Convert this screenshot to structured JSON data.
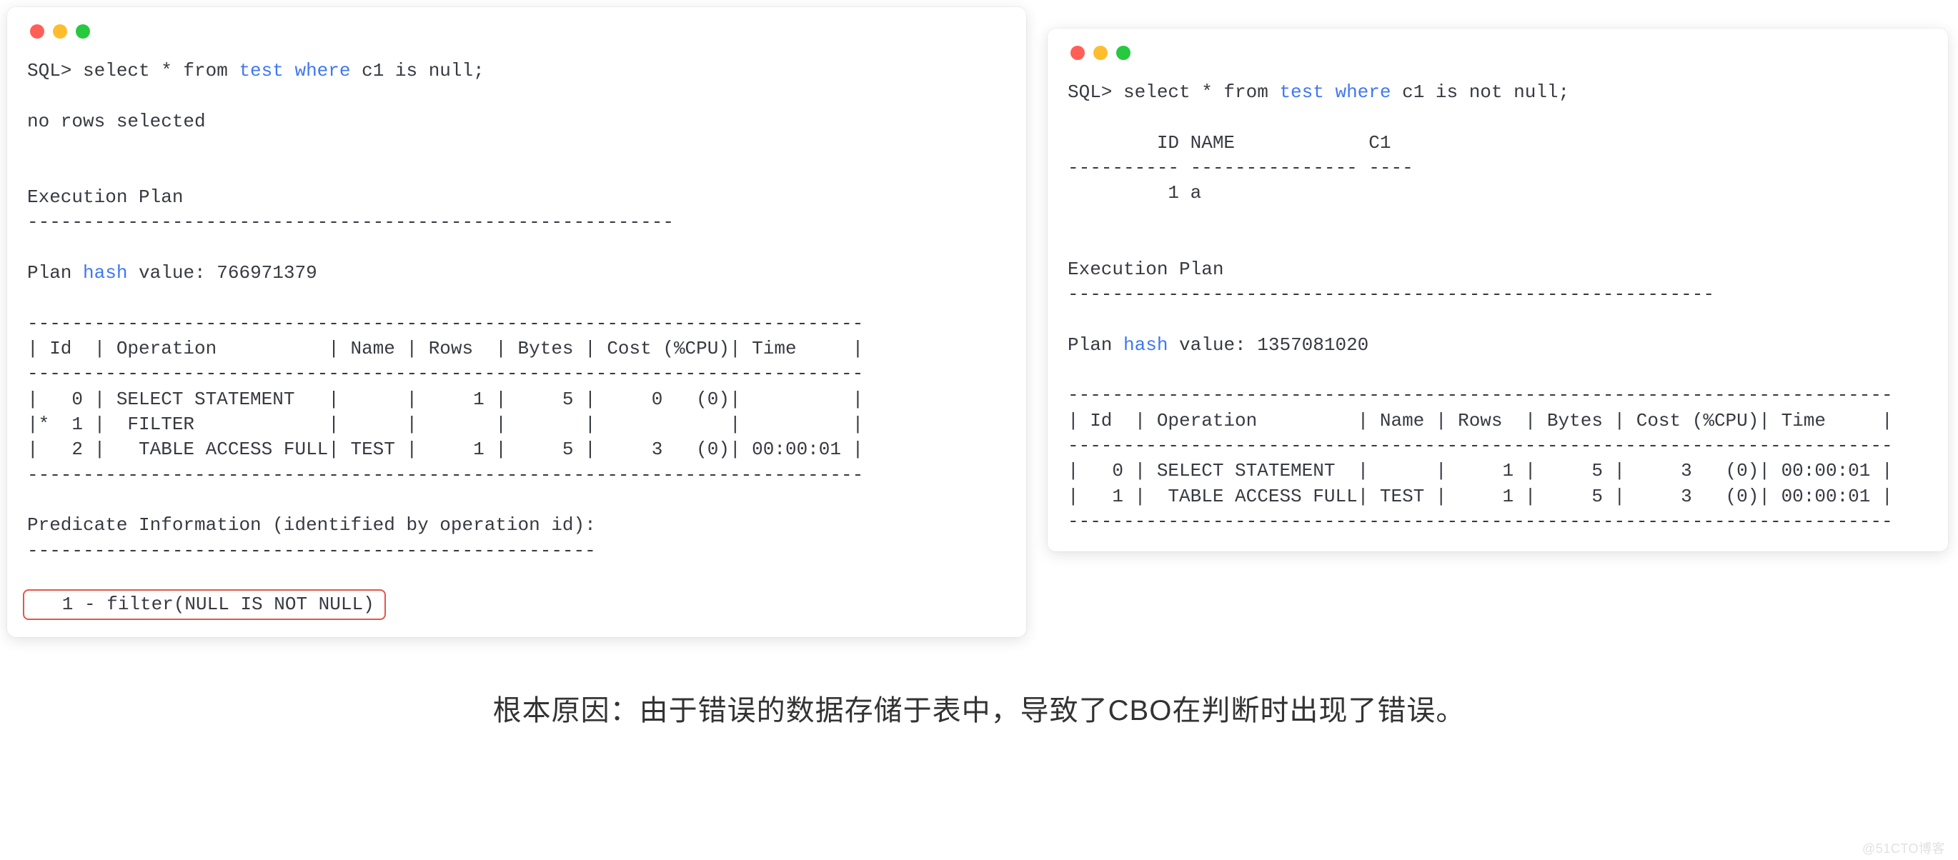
{
  "left": {
    "query_line": {
      "prefix": "SQL> select * from ",
      "kw": "test where",
      "suffix": " c1 is null;"
    },
    "no_rows": "no rows selected",
    "exec_label": "Execution Plan",
    "dash58": "----------------------------------------------------------",
    "hash_line": {
      "prefix": "Plan ",
      "kw": "hash",
      "suffix": " value: 766971379"
    },
    "dash75": "---------------------------------------------------------------------------",
    "header": "| Id  | Operation          | Name | Rows  | Bytes | Cost (%CPU)| Time     |",
    "row0": "|   0 | SELECT STATEMENT   |      |     1 |     5 |     0   (0)|          |",
    "row1": "|*  1 |  FILTER            |      |       |       |            |          |",
    "row2": "|   2 |   TABLE ACCESS FULL| TEST |     1 |     5 |     3   (0)| 00:00:01 |",
    "pred_label": "Predicate Information (identified by operation id):",
    "dash51": "---------------------------------------------------",
    "filter": "   1 - filter(NULL IS NOT NULL)"
  },
  "right": {
    "query_line": {
      "prefix": "SQL> select * from ",
      "kw": "test where",
      "suffix": " c1 is not null;"
    },
    "cols": "        ID NAME            C1",
    "seps": "---------- --------------- ----",
    "data": "         1 a",
    "exec_label": "Execution Plan",
    "dash58": "----------------------------------------------------------",
    "hash_line": {
      "prefix": "Plan ",
      "kw": "hash",
      "suffix": " value: 1357081020"
    },
    "dash74": "--------------------------------------------------------------------------",
    "header": "| Id  | Operation         | Name | Rows  | Bytes | Cost (%CPU)| Time     |",
    "row0": "|   0 | SELECT STATEMENT  |      |     1 |     5 |     3   (0)| 00:00:01 |",
    "row1": "|   1 |  TABLE ACCESS FULL| TEST |     1 |     5 |     3   (0)| 00:00:01 |"
  },
  "caption": "根本原因：由于错误的数据存储于表中，导致了CBO在判断时出现了错误。",
  "watermark": "@51CTO博客"
}
